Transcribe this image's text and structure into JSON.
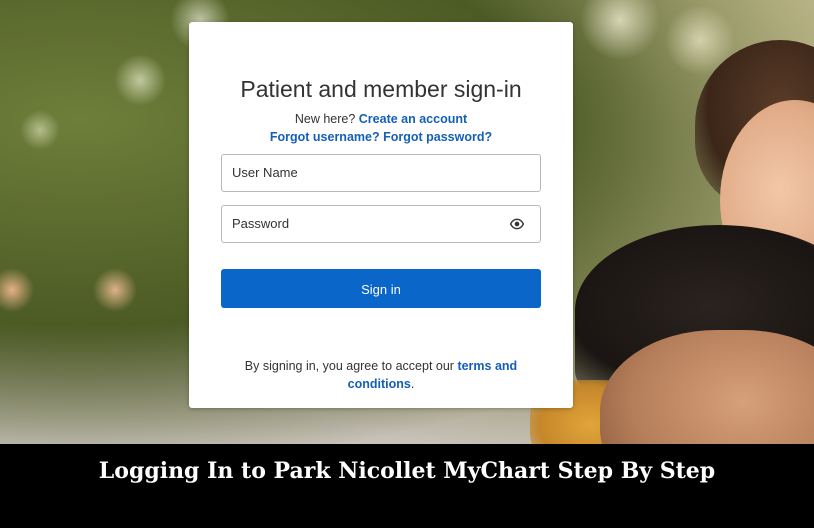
{
  "card": {
    "title": "Patient and member sign-in",
    "new_here_text": "New here?",
    "create_account_link": "Create an account",
    "forgot_username_link": "Forgot username?",
    "forgot_password_link": "Forgot password?",
    "username_placeholder": "User Name",
    "password_placeholder": "Password",
    "show_password_icon": "eye-icon",
    "sign_in_label": "Sign in",
    "terms_prefix": "By signing in, you agree to accept our",
    "terms_link": "terms and conditions",
    "terms_suffix": ".",
    "accent_color": "#0a66c8",
    "link_color": "#1460b8"
  },
  "banner": {
    "caption": "Logging In to Park Nicollet MyChart Step By Step"
  }
}
